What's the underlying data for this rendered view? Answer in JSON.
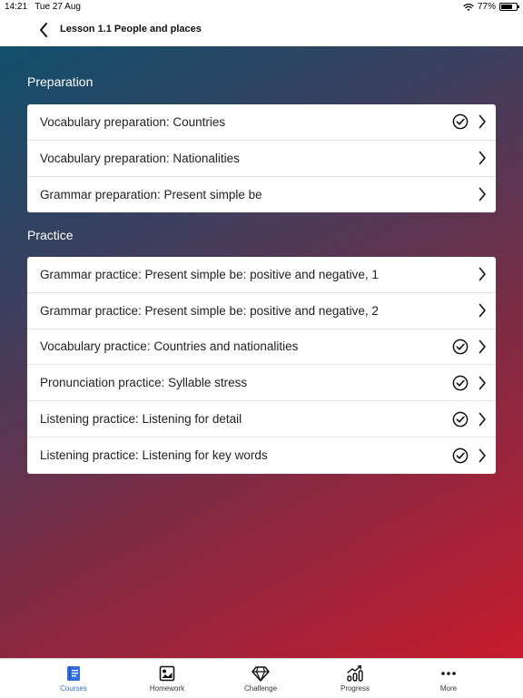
{
  "status": {
    "time": "14:21",
    "date": "Tue 27 Aug",
    "battery": "77%",
    "battery_level": 0.77
  },
  "nav": {
    "title": "Lesson 1.1 People and places",
    "back_icon": "chevron-left-icon"
  },
  "sections": [
    {
      "heading": "Preparation",
      "items": [
        {
          "label": "Vocabulary preparation: Countries",
          "completed": true
        },
        {
          "label": "Vocabulary preparation: Nationalities",
          "completed": false
        },
        {
          "label": "Grammar preparation: Present simple be",
          "completed": false
        }
      ]
    },
    {
      "heading": "Practice",
      "items": [
        {
          "label": "Grammar practice: Present simple be: positive and negative, 1",
          "completed": false
        },
        {
          "label": "Grammar practice: Present simple be: positive and negative, 2",
          "completed": false
        },
        {
          "label": "Vocabulary practice: Countries and nationalities",
          "completed": true
        },
        {
          "label": "Pronunciation practice: Syllable stress",
          "completed": true
        },
        {
          "label": "Listening practice: Listening for detail",
          "completed": true
        },
        {
          "label": "Listening practice: Listening for key words",
          "completed": true
        }
      ]
    }
  ],
  "tabs": [
    {
      "label": "Courses",
      "icon": "book-icon",
      "active": true
    },
    {
      "label": "Homework",
      "icon": "homework-icon",
      "active": false
    },
    {
      "label": "Challenge",
      "icon": "diamond-icon",
      "active": false
    },
    {
      "label": "Progress",
      "icon": "progress-chart-icon",
      "active": false
    },
    {
      "label": "More",
      "icon": "more-dots-icon",
      "active": false
    }
  ],
  "colors": {
    "accent": "#2f6fe0",
    "gradient_start": "#11506c",
    "gradient_end": "#c71b2e"
  }
}
